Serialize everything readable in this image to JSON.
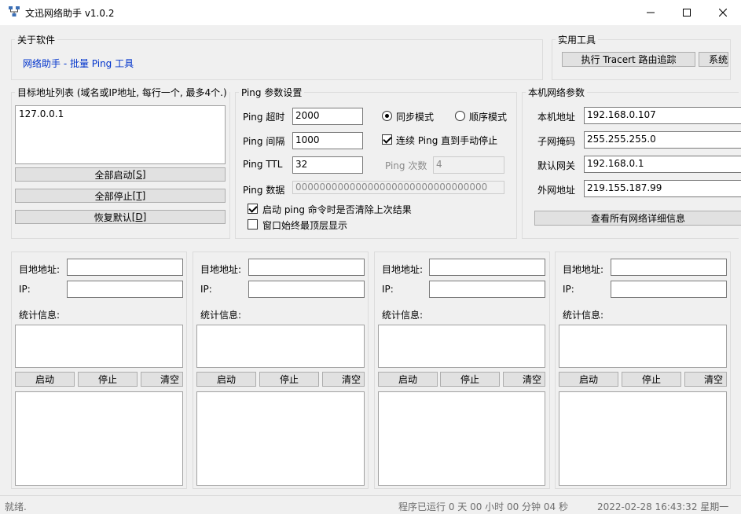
{
  "window": {
    "title": "文迅网络助手  v1.0.2"
  },
  "about": {
    "legend": "关于软件",
    "link": "网络助手 - 批量 Ping 工具"
  },
  "tools": {
    "legend": "实用工具",
    "tracert_button": "执行 Tracert 路由追踪",
    "system_button": "系统"
  },
  "targets": {
    "legend": "目标地址列表 (域名或IP地址, 每行一个, 最多4个.)",
    "list_value": "127.0.0.1",
    "start_all": "全部启动 ",
    "start_all_key": "[S]",
    "stop_all": "全部停止 ",
    "stop_all_key": "[T]",
    "restore": "恢复默认 ",
    "restore_key": "[D]"
  },
  "ping": {
    "legend": "Ping 参数设置",
    "timeout_label": "Ping 超时",
    "timeout_value": "2000",
    "interval_label": "Ping 间隔",
    "interval_value": "1000",
    "ttl_label": "Ping TTL",
    "ttl_value": "32",
    "data_label": "Ping 数据",
    "data_value": "00000000000000000000000000000000",
    "sync_mode": "同步模式",
    "seq_mode": "顺序模式",
    "continuous": "连续 Ping 直到手动停止",
    "count_label": "Ping 次数",
    "count_value": "4",
    "clear_on_start": "启动 ping 命令时是否清除上次结果",
    "always_on_top": "窗口始终最顶层显示"
  },
  "network": {
    "legend": "本机网络参数",
    "local_ip_label": "本机地址",
    "local_ip": "192.168.0.107",
    "mask_label": "子网掩码",
    "mask": "255.255.255.0",
    "gateway_label": "默认网关",
    "gateway": "192.168.0.1",
    "public_ip_label": "外网地址",
    "public_ip": "219.155.187.99",
    "details_button": "查看所有网络详细信息"
  },
  "panels": [
    {
      "dest_label": "目地地址:",
      "ip_label": "IP:",
      "stats_label": "统计信息:",
      "start": "启动",
      "stop": "停止",
      "clear": "清空"
    },
    {
      "dest_label": "目地地址:",
      "ip_label": "IP:",
      "stats_label": "统计信息:",
      "start": "启动",
      "stop": "停止",
      "clear": "清空"
    },
    {
      "dest_label": "目地地址:",
      "ip_label": "IP:",
      "stats_label": "统计信息:",
      "start": "启动",
      "stop": "停止",
      "clear": "清空"
    },
    {
      "dest_label": "目地地址:",
      "ip_label": "IP:",
      "stats_label": "统计信息:",
      "start": "启动",
      "stop": "停止",
      "clear": "清空"
    }
  ],
  "status": {
    "ready": "就绪.",
    "runtime": "程序已运行 0 天 00 小时 00 分钟 04 秒",
    "datetime": "2022-02-28 16:43:32 星期一"
  }
}
